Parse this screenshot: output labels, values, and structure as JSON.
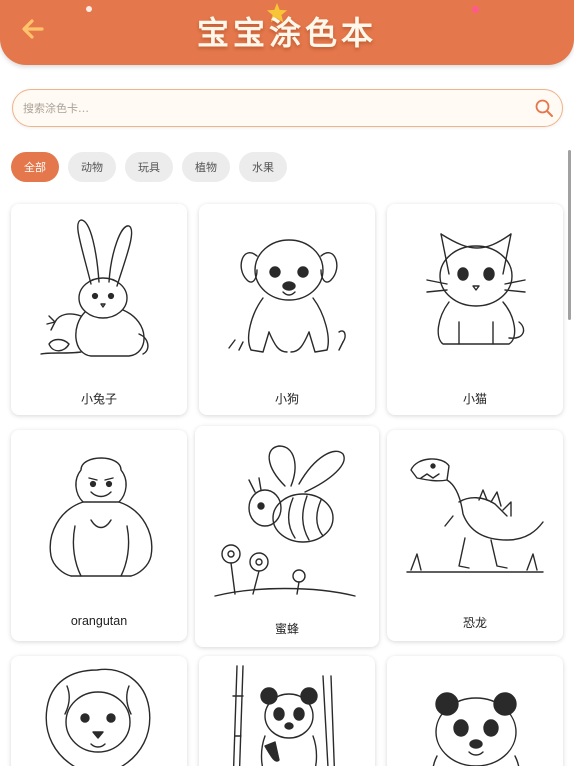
{
  "header": {
    "title": "宝宝涂色本",
    "back_icon": "arrow-left-icon",
    "colors": {
      "bar": "#e4774b",
      "back_arrow": "#ffc46b",
      "star": "#f7c637"
    }
  },
  "search": {
    "placeholder": "搜索涂色卡…",
    "value": "",
    "icon": "search-icon"
  },
  "categories": [
    {
      "label": "全部",
      "active": true
    },
    {
      "label": "动物",
      "active": false
    },
    {
      "label": "玩具",
      "active": false
    },
    {
      "label": "植物",
      "active": false
    },
    {
      "label": "水果",
      "active": false
    }
  ],
  "cards": [
    {
      "label": "小兔子",
      "art": "rabbit-drawing"
    },
    {
      "label": "小狗",
      "art": "puppy-drawing"
    },
    {
      "label": "小猫",
      "art": "kitten-drawing"
    },
    {
      "label": "orangutan",
      "art": "gorilla-drawing"
    },
    {
      "label": "蜜蜂",
      "art": "bee-drawing"
    },
    {
      "label": "恐龙",
      "art": "dinosaur-drawing"
    },
    {
      "label": "",
      "art": "lion-drawing"
    },
    {
      "label": "",
      "art": "panda-bamboo-drawing"
    },
    {
      "label": "",
      "art": "panda-drawing"
    }
  ]
}
